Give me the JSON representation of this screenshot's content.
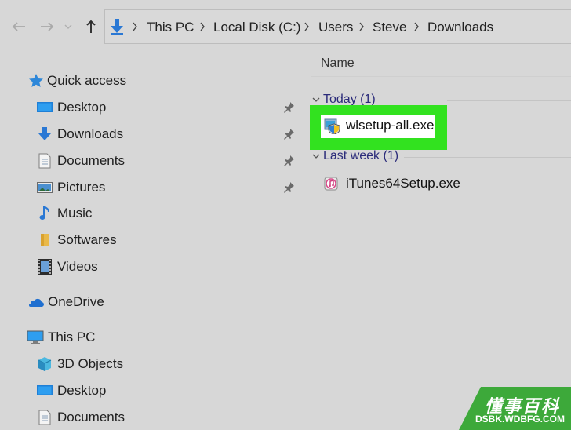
{
  "breadcrumb": [
    "This PC",
    "Local Disk (C:)",
    "Users",
    "Steve",
    "Downloads"
  ],
  "column_header": "Name",
  "groups": [
    {
      "label": "Today (1)",
      "files": [
        {
          "name": "wlsetup-all.exe",
          "icon": "setup-shield-icon",
          "highlighted": true
        }
      ]
    },
    {
      "label": "Last week (1)",
      "files": [
        {
          "name": "iTunes64Setup.exe",
          "icon": "itunes-icon",
          "highlighted": false
        }
      ]
    }
  ],
  "sidebar": {
    "quick_access": {
      "label": "Quick access",
      "items": [
        {
          "label": "Desktop",
          "icon": "desktop-icon",
          "pinned": true
        },
        {
          "label": "Downloads",
          "icon": "download-arrow-icon",
          "pinned": true
        },
        {
          "label": "Documents",
          "icon": "documents-icon",
          "pinned": true
        },
        {
          "label": "Pictures",
          "icon": "pictures-icon",
          "pinned": true
        },
        {
          "label": "Music",
          "icon": "music-note-icon",
          "pinned": false
        },
        {
          "label": "Softwares",
          "icon": "folder-icon",
          "pinned": false
        },
        {
          "label": "Videos",
          "icon": "videos-icon",
          "pinned": false
        }
      ]
    },
    "onedrive": {
      "label": "OneDrive"
    },
    "this_pc": {
      "label": "This PC",
      "items": [
        {
          "label": "3D Objects",
          "icon": "3d-objects-icon"
        },
        {
          "label": "Desktop",
          "icon": "desktop-icon"
        },
        {
          "label": "Documents",
          "icon": "documents-icon"
        }
      ]
    }
  },
  "watermark": {
    "chinese": "懂事百科",
    "url": "DSBK.WDBFG.COM"
  },
  "colors": {
    "highlight": "#32e21f",
    "background": "#d7d7d7",
    "group_header": "#2b2b7a",
    "accent_blue": "#1e6fd0"
  }
}
